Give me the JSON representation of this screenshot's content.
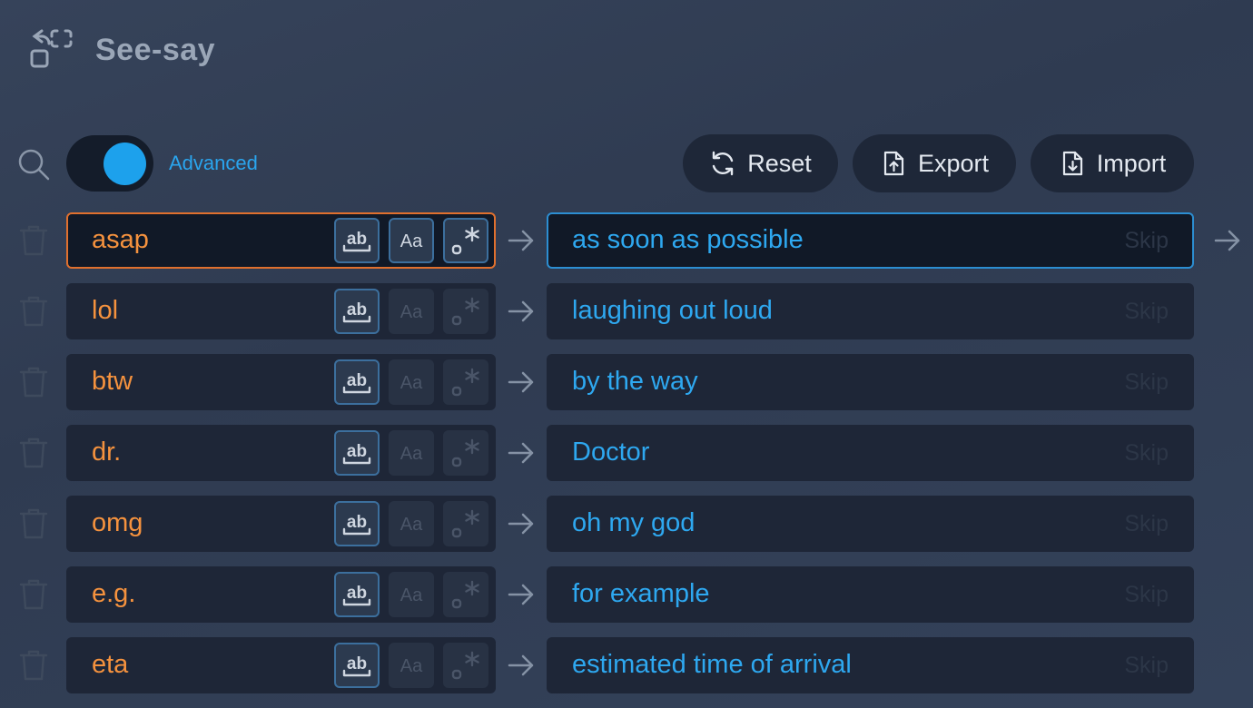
{
  "app": {
    "title": "See-say"
  },
  "toolbar": {
    "advanced_label": "Advanced",
    "advanced_enabled": true,
    "reset_label": "Reset",
    "export_label": "Export",
    "import_label": "Import"
  },
  "colors": {
    "background": "#323e55",
    "accent_blue": "#2ea8f0",
    "key_orange": "#f5923e",
    "active_key_border": "#e0702e",
    "active_value_border": "#2c8ed2"
  },
  "rules": [
    {
      "key": "asap",
      "value": "as soon as possible",
      "skip_label": "Skip",
      "match_word": true,
      "match_case": true,
      "regex": true,
      "active": true
    },
    {
      "key": "lol",
      "value": "laughing out loud",
      "skip_label": "Skip",
      "match_word": true,
      "match_case": false,
      "regex": false,
      "active": false
    },
    {
      "key": "btw",
      "value": "by the way",
      "skip_label": "Skip",
      "match_word": true,
      "match_case": false,
      "regex": false,
      "active": false
    },
    {
      "key": "dr.",
      "value": "Doctor",
      "skip_label": "Skip",
      "match_word": true,
      "match_case": false,
      "regex": false,
      "active": false
    },
    {
      "key": "omg",
      "value": "oh my god",
      "skip_label": "Skip",
      "match_word": true,
      "match_case": false,
      "regex": false,
      "active": false
    },
    {
      "key": "e.g.",
      "value": "for example",
      "skip_label": "Skip",
      "match_word": true,
      "match_case": false,
      "regex": false,
      "active": false
    },
    {
      "key": "eta",
      "value": "estimated time of arrival",
      "skip_label": "Skip",
      "match_word": true,
      "match_case": false,
      "regex": false,
      "active": false
    }
  ]
}
